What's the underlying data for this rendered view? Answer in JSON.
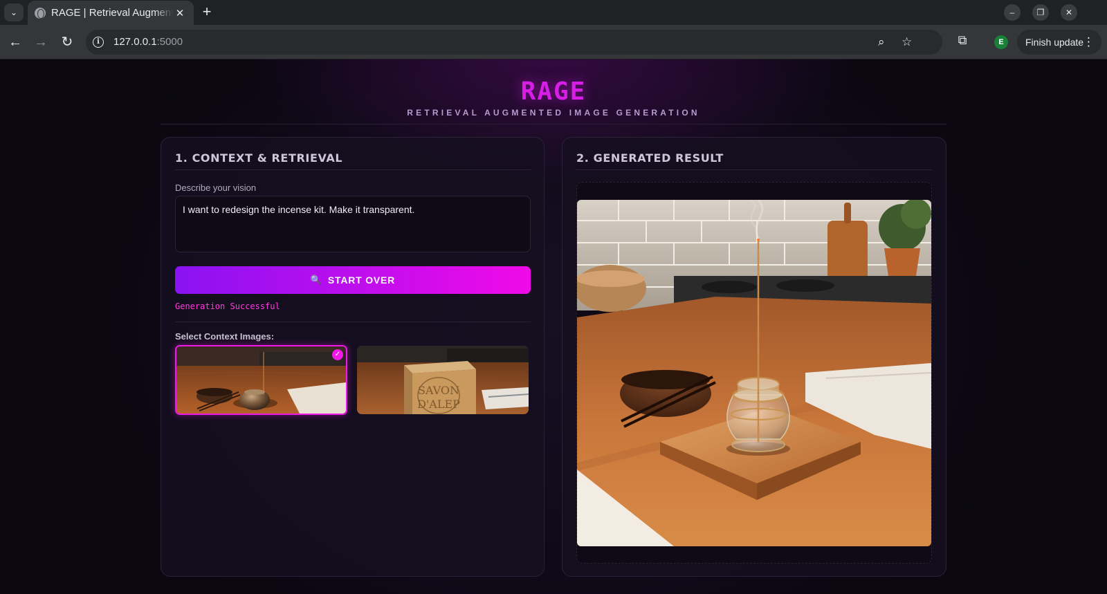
{
  "browser": {
    "tab_title": "RAGE | Retrieval Augmented Image Generation",
    "url_host": "127.0.0.1",
    "url_port": ":5000",
    "profile_initial": "E",
    "finish_update_label": "Finish update"
  },
  "header": {
    "title": "RAGE",
    "subtitle": "RETRIEVAL AUGMENTED IMAGE GENERATION"
  },
  "left_panel": {
    "title": "1. CONTEXT & RETRIEVAL",
    "vision_label": "Describe your vision",
    "vision_value": "I want to redesign the incense kit. Make it transparent.",
    "start_button_label": "START OVER",
    "status_text": "Generation Successful",
    "select_label": "Select Context Images:",
    "context_images": [
      {
        "name": "incense-kit",
        "selected": true
      },
      {
        "name": "savon-dalep-soap",
        "selected": false,
        "stamp_line_1": "SAVON",
        "stamp_line_2": "D'ALEP"
      }
    ]
  },
  "right_panel": {
    "title": "2. GENERATED RESULT"
  },
  "colors": {
    "accent": "#d61ee6",
    "button_start": "#8a12f2",
    "button_end": "#f00ae8",
    "status": "#ff3ce0"
  }
}
